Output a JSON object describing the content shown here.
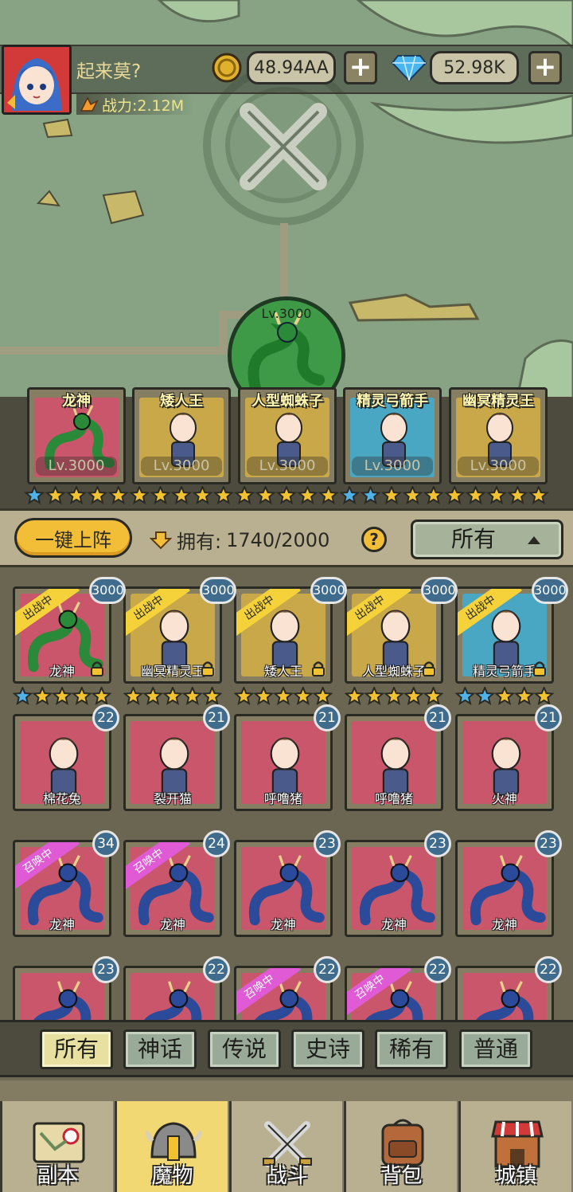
{
  "player": {
    "name": "起来莫?",
    "power_label": "战力:2.12M"
  },
  "resources": {
    "gold": "48.94AA",
    "diamonds": "52.98K",
    "plus": "+"
  },
  "featured": {
    "level": "Lv.3000"
  },
  "team": [
    {
      "name": "龙神",
      "level": "Lv.3000",
      "color": "#c9566a"
    },
    {
      "name": "矮人王",
      "level": "Lv.3000",
      "color": "#c8a849"
    },
    {
      "name": "人型蜘蛛子",
      "level": "Lv.3000",
      "color": "#c8a849"
    },
    {
      "name": "精灵弓箭手",
      "level": "Lv.3000",
      "color": "#4aa7c4"
    },
    {
      "name": "幽冥精灵王",
      "level": "Lv.3000",
      "color": "#c8a849"
    }
  ],
  "team_stars": {
    "blue": [
      0,
      15,
      16
    ],
    "count": 25
  },
  "actions": {
    "deploy_label": "一键上阵",
    "owned_label": "拥有:",
    "owned_value": "1740/2000",
    "help": "?",
    "filter_value": "所有"
  },
  "grid": {
    "row1": [
      {
        "name": "龙神",
        "badge": "3000",
        "ribbon": "出战中",
        "color": "#c9566a",
        "blue_stars": 1
      },
      {
        "name": "幽冥精灵王",
        "badge": "3000",
        "ribbon": "出战中",
        "color": "#c8a849",
        "blue_stars": 0
      },
      {
        "name": "矮人王",
        "badge": "3000",
        "ribbon": "出战中",
        "color": "#c8a849",
        "blue_stars": 0
      },
      {
        "name": "人型蜘蛛子",
        "badge": "3000",
        "ribbon": "出战中",
        "color": "#c8a849",
        "blue_stars": 0
      },
      {
        "name": "精灵弓箭手",
        "badge": "3000",
        "ribbon": "出战中",
        "color": "#4aa7c4",
        "blue_stars": 2
      }
    ],
    "row2": [
      {
        "name": "棉花兔",
        "badge": "22"
      },
      {
        "name": "裂开猫",
        "badge": "21"
      },
      {
        "name": "呼噜猪",
        "badge": "21"
      },
      {
        "name": "呼噜猪",
        "badge": "21"
      },
      {
        "name": "火神",
        "badge": "21"
      }
    ],
    "row3": [
      {
        "name": "龙神",
        "badge": "34",
        "ribbon": "召唤中"
      },
      {
        "name": "龙神",
        "badge": "24",
        "ribbon": "召唤中"
      },
      {
        "name": "龙神",
        "badge": "23"
      },
      {
        "name": "龙神",
        "badge": "23"
      },
      {
        "name": "龙神",
        "badge": "23"
      }
    ],
    "row4": [
      {
        "badge": "23"
      },
      {
        "badge": "22"
      },
      {
        "badge": "22",
        "ribbon": "召唤中"
      },
      {
        "badge": "22",
        "ribbon": "召唤中"
      },
      {
        "badge": "22"
      }
    ]
  },
  "rarity_tabs": [
    "所有",
    "神话",
    "传说",
    "史诗",
    "稀有",
    "普通"
  ],
  "nav": [
    "副本",
    "魔物",
    "战斗",
    "背包",
    "城镇"
  ],
  "colors": {
    "card_red": "#c9566a",
    "card_gold": "#c8a849",
    "card_blue": "#4aa7c4",
    "active_tab": "#f2d873"
  }
}
